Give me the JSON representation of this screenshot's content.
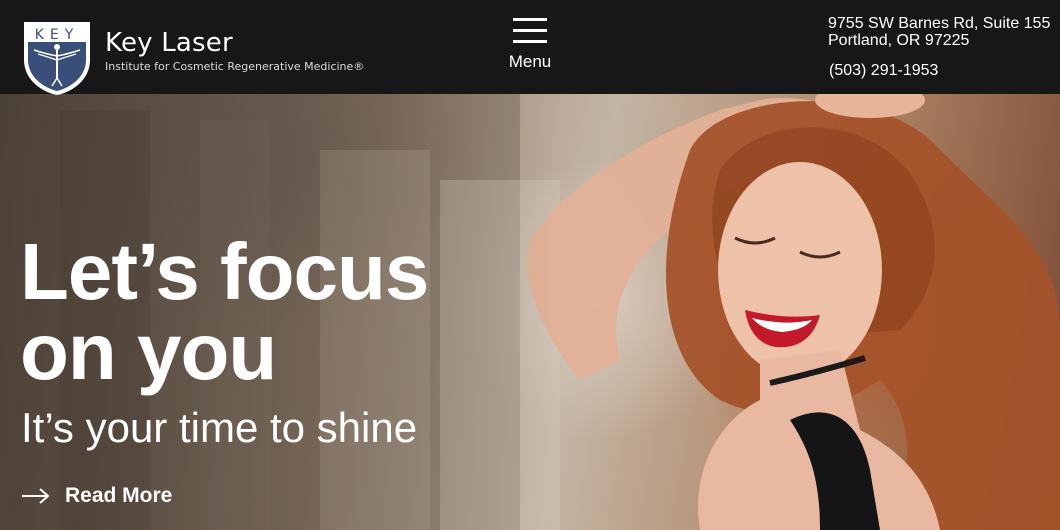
{
  "brand": {
    "logo_letters": "KEY",
    "name": "Key Laser",
    "subtitle": "Institute for Cosmetic Regenerative Medicine®"
  },
  "header": {
    "menu_label": "Menu",
    "address_line1": "9755 SW Barnes Rd, Suite 155",
    "address_line2": "Portland, OR 97225",
    "phone": "(503) 291-1953"
  },
  "hero": {
    "headline_line1": "Let’s focus",
    "headline_line2": "on you",
    "tagline": "It’s your time to shine",
    "cta_label": "Read More",
    "image_description": "smiling woman with long red wavy hair"
  },
  "colors": {
    "header_bg": "#171717",
    "text": "#ffffff",
    "shield": "#3a4e7a"
  },
  "icons": [
    "menu-icon",
    "arrow-right-icon",
    "shield-logo-icon"
  ]
}
